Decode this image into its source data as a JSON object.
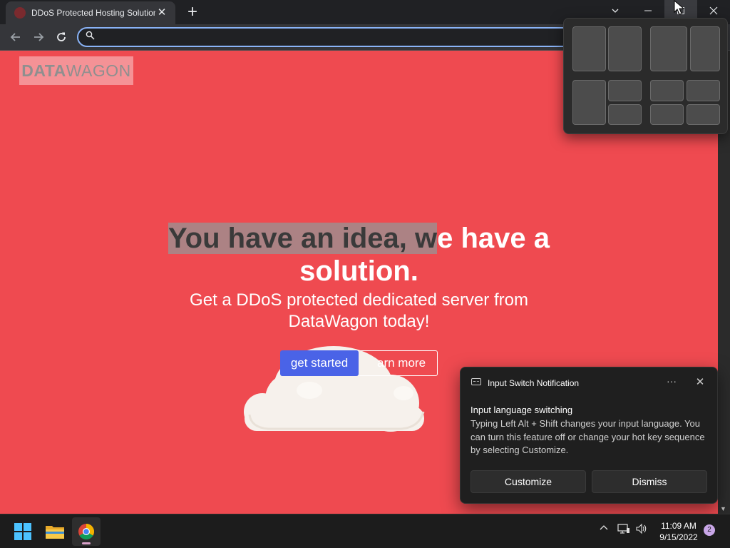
{
  "browser": {
    "tab": {
      "title": "DDoS Protected Hosting Solutions",
      "close": "✕"
    },
    "new_tab": "+",
    "omnibox": {
      "value": "",
      "placeholder": ""
    }
  },
  "page": {
    "logo": {
      "part1": "DATA",
      "part2": "WAGON"
    },
    "hero": {
      "title_highlighted": "You have an idea, w",
      "title_rest": "e have a solution.",
      "subtitle": "Get a DDoS protected dedicated server from DataWagon today!"
    },
    "buttons": {
      "get_started": "get started",
      "learn_more": "arn more"
    }
  },
  "notification": {
    "app": "Input Switch Notification",
    "more": "···",
    "close": "✕",
    "heading": "Input language switching",
    "body": "Typing Left Alt + Shift changes your input language. You can turn this feature off or change your hot key sequence by selecting Customize.",
    "customize": "Customize",
    "dismiss": "Dismiss"
  },
  "taskbar": {
    "time": "11:09 AM",
    "date": "9/15/2022",
    "notification_count": "2"
  },
  "colors": {
    "page_bg": "#ef4a50",
    "primary_button": "#4a63e7",
    "omnibox_focus": "#8ab4f8"
  },
  "icons": [
    "favicon-icon",
    "close-icon",
    "plus-icon",
    "chevron-down-icon",
    "minimize-icon",
    "maximize-icon",
    "back-icon",
    "forward-icon",
    "reload-icon",
    "search-icon",
    "cloud-illustration",
    "windows-start-icon",
    "file-explorer-icon",
    "chrome-icon",
    "chevron-up-icon",
    "network-icon",
    "volume-icon",
    "cursor-icon"
  ]
}
